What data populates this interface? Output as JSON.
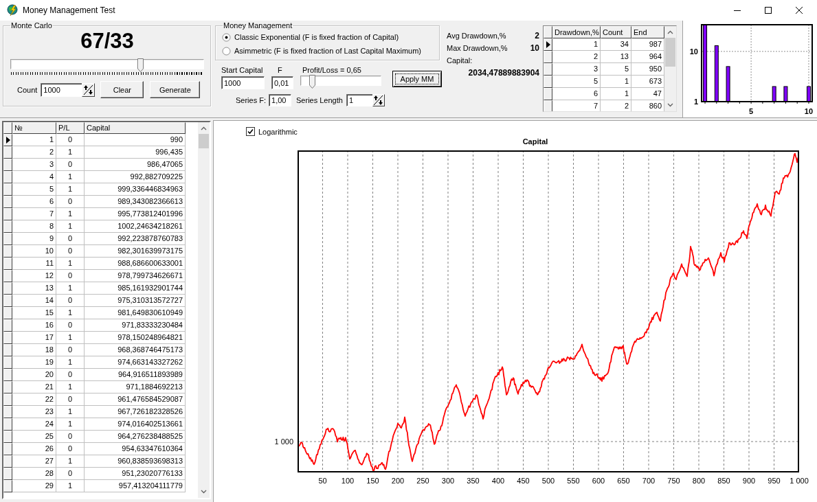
{
  "window": {
    "title": "Money Management Test"
  },
  "monte_carlo": {
    "title": "Monte Carlo",
    "ratio": "67/33",
    "ratio_slider": {
      "level": 0.68
    },
    "count": {
      "label": "Count",
      "value": "1000"
    },
    "buttons": [
      {
        "label": "Clear"
      },
      {
        "label": "Generate"
      }
    ]
  },
  "money_management": {
    "title": "Money Management",
    "options": [
      {
        "label": "Classic Exponential (F is fixed fraction of Capital)",
        "selected": true
      },
      {
        "label": "Asimmetric (F is fixed fraction of Last Capital Maximum)",
        "selected": false
      }
    ],
    "start_capital": {
      "label": "Start Capital",
      "value": "1000"
    },
    "f": {
      "label": "F",
      "value": "0,01"
    },
    "profit_loss": {
      "label": "Profit/Loss = 0,65",
      "level": 0.11
    },
    "apply_button": {
      "label": "Apply MM"
    },
    "series_f": {
      "label": "Series F:",
      "value": "1,00"
    },
    "series_length": {
      "label": "Series Length",
      "value": "1"
    }
  },
  "statistics": {
    "rows": [
      {
        "label": "Avg Drawdown,%",
        "value": "2"
      },
      {
        "label": "Max Drawdown,%",
        "value": "10"
      }
    ],
    "capital_label": "Capital:",
    "capital_value": "2034,47889883904"
  },
  "drawdown_table": {
    "columns": [
      "Drawdown,%",
      "Count",
      "End"
    ],
    "rows": [
      {
        "selected": true,
        "cells": [
          "1",
          "34",
          "987"
        ]
      },
      {
        "selected": false,
        "cells": [
          "2",
          "13",
          "964"
        ]
      },
      {
        "selected": false,
        "cells": [
          "3",
          "5",
          "950"
        ]
      },
      {
        "selected": false,
        "cells": [
          "5",
          "1",
          "673"
        ]
      },
      {
        "selected": false,
        "cells": [
          "6",
          "1",
          "47"
        ]
      },
      {
        "selected": false,
        "cells": [
          "7",
          "2",
          "860"
        ]
      }
    ]
  },
  "drawdown_histogram": {
    "chart_data": {
      "type": "bar",
      "x": [
        1,
        2,
        3,
        7,
        8,
        10
      ],
      "values": [
        34,
        13,
        5,
        2,
        2,
        2
      ],
      "color": "#8000ff",
      "log": true,
      "xlim": [
        0.7,
        10.3
      ],
      "ylim": [
        1,
        34
      ],
      "xticks": [
        5,
        10
      ],
      "yticks": [
        1,
        10
      ],
      "grid": true
    }
  },
  "trades_table": {
    "columns": [
      "№",
      "P/L",
      "Capital"
    ],
    "rows": [
      {
        "selected": true,
        "cells": [
          "1",
          "0",
          "990"
        ]
      },
      {
        "selected": false,
        "cells": [
          "2",
          "1",
          "996,435"
        ]
      },
      {
        "selected": false,
        "cells": [
          "3",
          "0",
          "986,47065"
        ]
      },
      {
        "selected": false,
        "cells": [
          "4",
          "1",
          "992,882709225"
        ]
      },
      {
        "selected": false,
        "cells": [
          "5",
          "1",
          "999,336446834963"
        ]
      },
      {
        "selected": false,
        "cells": [
          "6",
          "0",
          "989,343082366613"
        ]
      },
      {
        "selected": false,
        "cells": [
          "7",
          "1",
          "995,773812401996"
        ]
      },
      {
        "selected": false,
        "cells": [
          "8",
          "1",
          "1002,24634218261"
        ]
      },
      {
        "selected": false,
        "cells": [
          "9",
          "0",
          "992,223878760783"
        ]
      },
      {
        "selected": false,
        "cells": [
          "10",
          "0",
          "982,301639973175"
        ]
      },
      {
        "selected": false,
        "cells": [
          "11",
          "1",
          "988,686600633001"
        ]
      },
      {
        "selected": false,
        "cells": [
          "12",
          "0",
          "978,799734626671"
        ]
      },
      {
        "selected": false,
        "cells": [
          "13",
          "1",
          "985,161932901744"
        ]
      },
      {
        "selected": false,
        "cells": [
          "14",
          "0",
          "975,310313572727"
        ]
      },
      {
        "selected": false,
        "cells": [
          "15",
          "1",
          "981,649830610949"
        ]
      },
      {
        "selected": false,
        "cells": [
          "16",
          "0",
          "971,83333230484"
        ]
      },
      {
        "selected": false,
        "cells": [
          "17",
          "1",
          "978,150248964821"
        ]
      },
      {
        "selected": false,
        "cells": [
          "18",
          "0",
          "968,368746475173"
        ]
      },
      {
        "selected": false,
        "cells": [
          "19",
          "1",
          "974,663143327262"
        ]
      },
      {
        "selected": false,
        "cells": [
          "20",
          "0",
          "964,916511893989"
        ]
      },
      {
        "selected": false,
        "cells": [
          "21",
          "1",
          "971,1884692213"
        ]
      },
      {
        "selected": false,
        "cells": [
          "22",
          "0",
          "961,476584529087"
        ]
      },
      {
        "selected": false,
        "cells": [
          "23",
          "1",
          "967,726182328526"
        ]
      },
      {
        "selected": false,
        "cells": [
          "24",
          "1",
          "974,016402513661"
        ]
      },
      {
        "selected": false,
        "cells": [
          "25",
          "0",
          "964,276238488525"
        ]
      },
      {
        "selected": false,
        "cells": [
          "26",
          "0",
          "954,63347610364"
        ]
      },
      {
        "selected": false,
        "cells": [
          "27",
          "1",
          "960,838593698313"
        ]
      },
      {
        "selected": false,
        "cells": [
          "28",
          "0",
          "951,23020776133"
        ]
      },
      {
        "selected": false,
        "cells": [
          "29",
          "1",
          "957,413204111779"
        ]
      }
    ]
  },
  "capital_chart": {
    "logarithmic": {
      "label": "Logarithmic",
      "checked": true
    },
    "title": "Capital",
    "y_tick_labels": [
      "1 000"
    ],
    "x_tick_labels": [
      "50",
      "100",
      "150",
      "200",
      "250",
      "300",
      "350",
      "400",
      "450",
      "500",
      "550",
      "600",
      "650",
      "700",
      "750",
      "800",
      "850",
      "900",
      "950",
      "1 000"
    ]
  }
}
